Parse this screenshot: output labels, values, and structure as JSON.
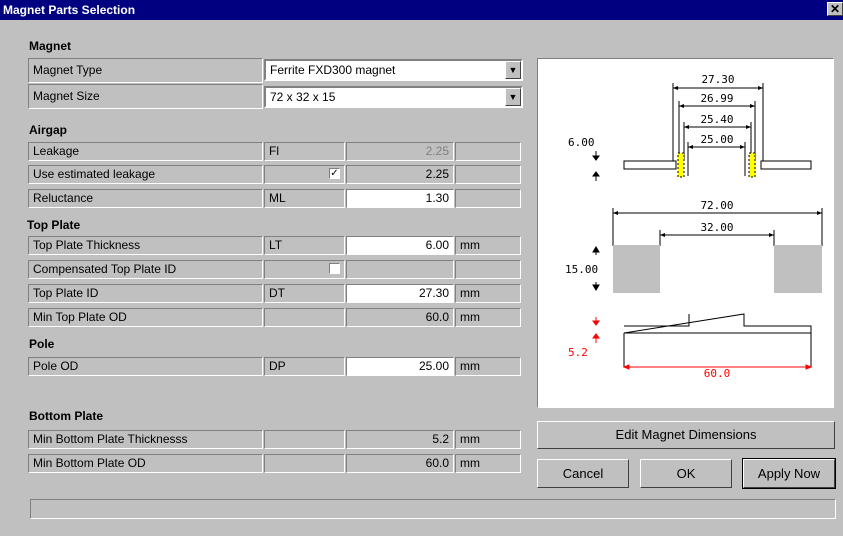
{
  "window": {
    "title": "Magnet Parts Selection",
    "close_glyph": "✕"
  },
  "sections": {
    "magnet": "Magnet",
    "airgap": "Airgap",
    "top_plate": "Top Plate",
    "pole": "Pole",
    "bottom_plate": "Bottom Plate"
  },
  "magnet": {
    "type_label": "Magnet Type",
    "type_value": "Ferrite FXD300 magnet",
    "size_label": "Magnet Size",
    "size_value": "72 x 32 x 15"
  },
  "airgap": {
    "leakage": {
      "label": "Leakage",
      "sym": "Fl",
      "value": "2.25"
    },
    "use_est": {
      "label": "Use estimated leakage",
      "check": "✓",
      "value": "2.25"
    },
    "reluctance": {
      "label": "Reluctance",
      "sym": "ML",
      "value": "1.30"
    }
  },
  "top_plate": {
    "thickness": {
      "label": "Top Plate Thickness",
      "sym": "LT",
      "value": "6.00",
      "unit": "mm"
    },
    "comp": {
      "label": "Compensated Top Plate ID",
      "check": ""
    },
    "id": {
      "label": "Top Plate ID",
      "sym": "DT",
      "value": "27.30",
      "unit": "mm"
    },
    "min_od": {
      "label": "Min Top Plate OD",
      "value": "60.0",
      "unit": "mm"
    }
  },
  "pole": {
    "od": {
      "label": "Pole OD",
      "sym": "DP",
      "value": "25.00",
      "unit": "mm"
    }
  },
  "bottom_plate": {
    "thickness": {
      "label": "Min Bottom Plate Thicknesss",
      "value": "5.2",
      "unit": "mm"
    },
    "od": {
      "label": "Min Bottom Plate OD",
      "value": "60.0",
      "unit": "mm"
    }
  },
  "diagram": {
    "d1": "27.30",
    "d2": "26.99",
    "d3": "25.40",
    "d4": "25.00",
    "top_thick": "6.00",
    "mag_od": "72.00",
    "mag_id": "32.00",
    "mag_h": "15.00",
    "bot_thick": "5.2",
    "bot_od": "60.0",
    "accent_red": "#ff0000",
    "coil_yellow": "#ffff00"
  },
  "buttons": {
    "edit": "Edit Magnet Dimensions",
    "cancel": "Cancel",
    "ok": "OK",
    "apply": "Apply Now"
  }
}
